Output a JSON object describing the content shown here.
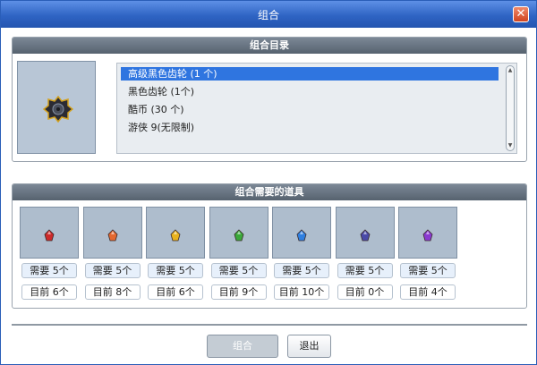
{
  "window": {
    "title": "组合",
    "close_label": "✕"
  },
  "catalog": {
    "header": "组合目录",
    "preview_icon": "black-gear-icon",
    "items": [
      {
        "label": "高级黑色齿轮 (1 个)",
        "selected": true
      },
      {
        "label": "黑色齿轮 (1个)",
        "selected": false
      },
      {
        "label": "酷币 (30 个)",
        "selected": false
      },
      {
        "label": "游侠 9(无限制)",
        "selected": false
      }
    ]
  },
  "requirements": {
    "header": "组合需要的道具",
    "items": [
      {
        "icon": "red-gem-icon",
        "color": "#cc2a2a",
        "need": "需要 5个",
        "current": "目前 6个"
      },
      {
        "icon": "orange-gem-icon",
        "color": "#e4682e",
        "need": "需要 5个",
        "current": "目前 8个"
      },
      {
        "icon": "yellow-gem-icon",
        "color": "#e8b21e",
        "need": "需要 5个",
        "current": "目前 6个"
      },
      {
        "icon": "green-gem-icon",
        "color": "#3aa83a",
        "need": "需要 5个",
        "current": "目前 9个"
      },
      {
        "icon": "blue-gem-icon",
        "color": "#2f7fe0",
        "need": "需要 5个",
        "current": "目前 10个"
      },
      {
        "icon": "indigo-gem-icon",
        "color": "#4a4aa8",
        "need": "需要 5个",
        "current": "目前 0个"
      },
      {
        "icon": "purple-gem-icon",
        "color": "#8a3ad0",
        "need": "需要 5个",
        "current": "目前 4个"
      }
    ]
  },
  "buttons": {
    "combine": "组合",
    "exit": "退出"
  }
}
